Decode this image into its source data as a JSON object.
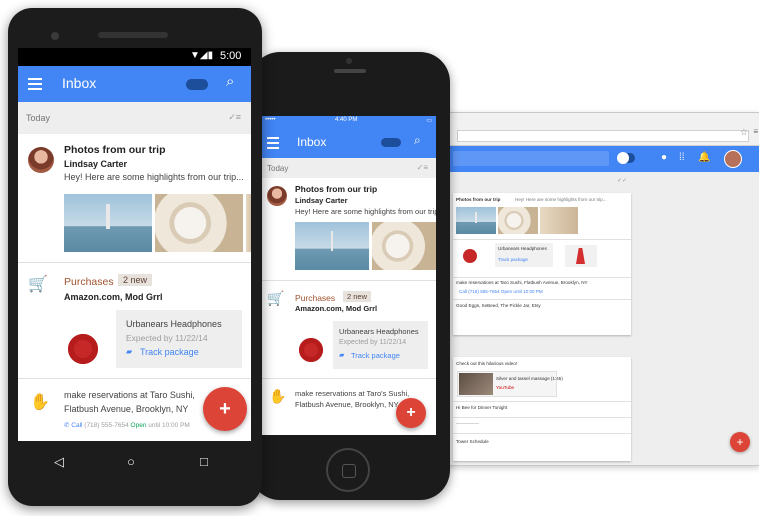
{
  "colors": {
    "primary": "#4285f4",
    "fab": "#db4437",
    "purchases": "#a0522d",
    "link": "#4285f4"
  },
  "android": {
    "status_time": "5:00",
    "app_title": "Inbox",
    "section_today": "Today",
    "email1": {
      "subject": "Photos from our trip",
      "sender": "Lindsay Carter",
      "snippet": "Hey! Here are some highlights from our trip..."
    },
    "bundle": {
      "label": "Purchases",
      "badge": "2 new",
      "senders": "Amazon.com, Mod Grrl"
    },
    "product": {
      "name": "Urbanears Headphones",
      "expected": "Expected by 11/22/14",
      "action": "Track package"
    },
    "reminder": {
      "line1": "make reservations at Taro Sushi,",
      "line2": "Flatbush Avenue, Brooklyn, NY",
      "call_label": "Call",
      "phone": "(718) 555-7654",
      "open_label": "Open",
      "hours": "until 10:00 PM"
    },
    "fab_label": "+"
  },
  "iphone": {
    "status_time": "4:40 PM",
    "app_title": "Inbox",
    "section_today": "Today",
    "email1": {
      "subject": "Photos from our trip",
      "sender": "Lindsay Carter",
      "snippet": "Hey! Here are some highlights from our trip..."
    },
    "bundle": {
      "label": "Purchases",
      "badge": "2 new",
      "senders": "Amazon.com, Mod Grrl"
    },
    "product": {
      "name": "Urbanears Headphones",
      "expected": "Expected by 11/22/14",
      "action": "Track package"
    },
    "reminder": {
      "line1": "make reservations at Taro's Sushi,",
      "line2": "Flatbush Avenue, Brooklyn, NY"
    },
    "fab_label": "+"
  },
  "desktop": {
    "card1": {
      "subject": "Photos from our trip",
      "snippet": "Hey! Here are some highlights from our trip...",
      "tag": "Urbanears Headphones",
      "track": "Track package",
      "row1": "make reservations at Taro Sushi, Flatbush Avenue, Brooklyn, NY",
      "row2": "Call (718) 555-7654 Open until 10:00 PM",
      "row3": "Good Eggs, SeBeed, The Pickle Jar, Etsy"
    },
    "card2": {
      "row1": "Check out this hilarious video!",
      "video_title": "Silver and tassel massage (1:45)",
      "video_source": "YouTube",
      "row2": "Hi Bee for Dinner Tonight",
      "row3": "Tower Schedule"
    },
    "fab_label": "+"
  },
  "icons": {
    "menu": "hamburger-icon",
    "search": "search-icon",
    "done": "done-all-icon",
    "cart": "cart-icon",
    "reminder": "reminder-hand-icon",
    "truck": "truck-icon",
    "phone": "phone-icon",
    "back": "back-icon",
    "home": "home-icon",
    "recents": "recents-icon"
  }
}
